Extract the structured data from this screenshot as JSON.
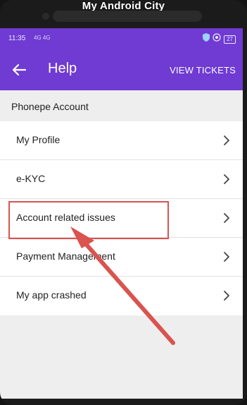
{
  "watermark": "My Android City",
  "status_bar": {
    "time": "11:35",
    "signal_text": "4G 4G",
    "battery": "27"
  },
  "app_bar": {
    "title": "Help",
    "action_label": "VIEW TICKETS"
  },
  "section": {
    "title": "Phonepe Account"
  },
  "items": [
    {
      "label": "My Profile"
    },
    {
      "label": "e-KYC"
    },
    {
      "label": "Account related issues"
    },
    {
      "label": "Payment Management"
    },
    {
      "label": "My app crashed"
    }
  ],
  "colors": {
    "brand_purple": "#6f3bd2",
    "annotation_red": "#d9534f"
  },
  "icons": {
    "back": "arrow-left-icon",
    "row": "chevron-right-icon"
  }
}
